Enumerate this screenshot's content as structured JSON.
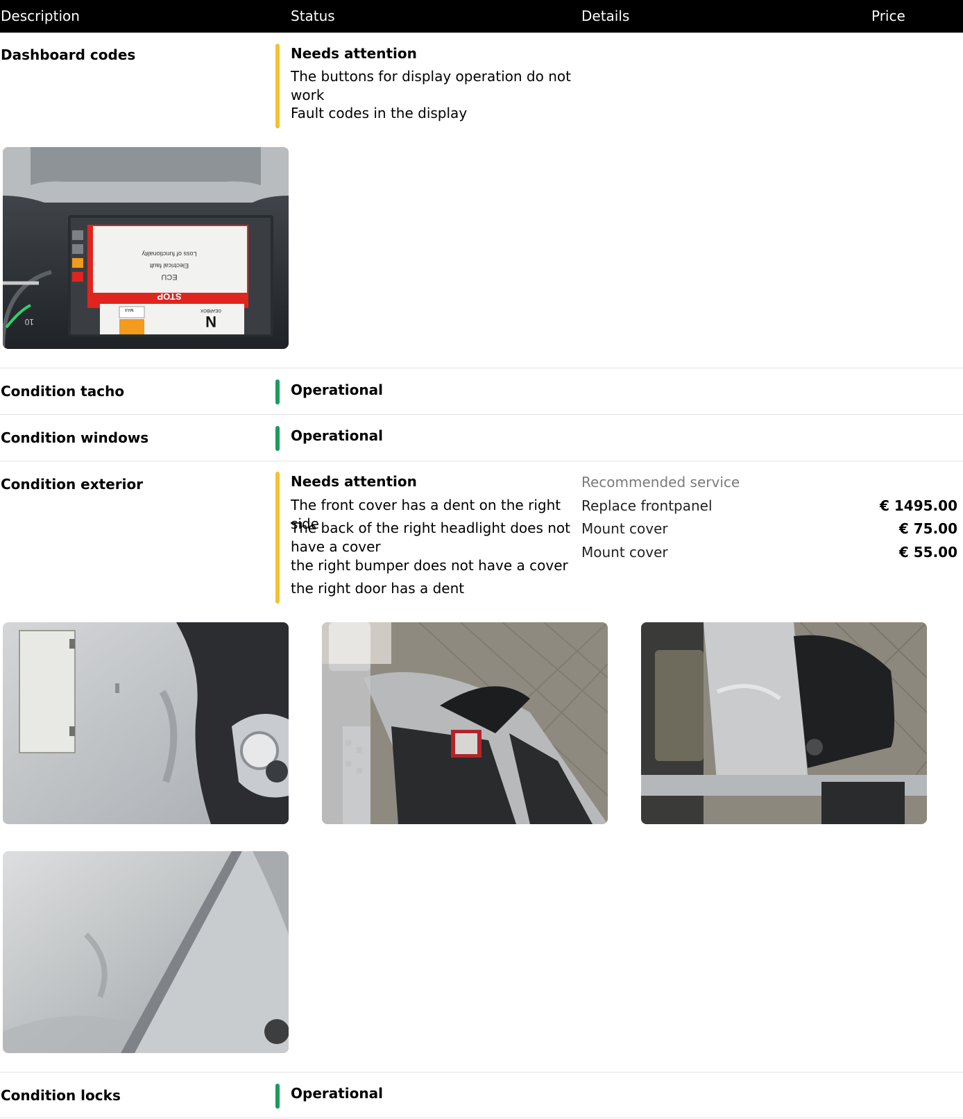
{
  "header": {
    "description": "Description",
    "status": "Status",
    "details": "Details",
    "price": "Price"
  },
  "rows": [
    {
      "title": "Dashboard codes",
      "status": "Needs attention",
      "descriptions": [
        "The buttons for display operation do not work",
        "Fault codes in the display"
      ],
      "photo_text": {
        "stop": "STOP",
        "ecu": "ECU",
        "fault1": "Electrical fault",
        "fault2": "Loss of functionality",
        "gear": "N",
        "gearbox": "GEARBOX",
        "max": "MAX",
        "gauge": "10"
      }
    },
    {
      "title": "Condition tacho",
      "status": "Operational"
    },
    {
      "title": "Condition windows",
      "status": "Operational"
    },
    {
      "title": "Condition exterior",
      "status": "Needs attention",
      "descriptions": [
        "The front cover has a dent on the right side",
        "The back of the right headlight does not have a cover",
        "the right bumper does not have a cover",
        "the right door has a dent"
      ],
      "details_heading": "Recommended service",
      "services": [
        {
          "name": "Replace frontpanel",
          "price": "€ 1495.00"
        },
        {
          "name": "Mount cover",
          "price": "€ 75.00"
        },
        {
          "name": "Mount cover",
          "price": "€ 55.00"
        }
      ]
    },
    {
      "title": "Condition locks",
      "status": "Operational"
    }
  ],
  "colors": {
    "header_bg": "#000000",
    "needs_attention": "#f2c232",
    "operational": "#1a9c5b"
  }
}
